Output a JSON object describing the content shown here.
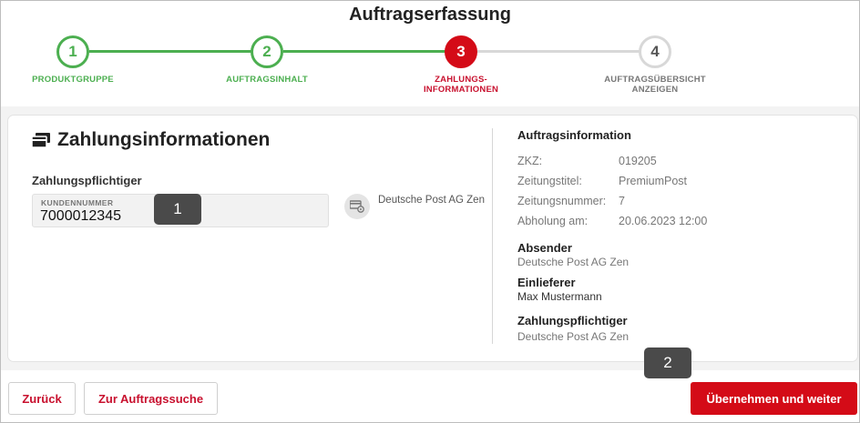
{
  "header": {
    "title": "Auftragserfassung"
  },
  "steps": [
    {
      "number": "1",
      "label": "PRODUKTGRUPPE",
      "state": "done"
    },
    {
      "number": "2",
      "label": "AUFTRAGSINHALT",
      "state": "done"
    },
    {
      "number": "3",
      "label": "ZAHLUNGS-\nINFORMATIONEN",
      "state": "active"
    },
    {
      "number": "4",
      "label": "AUFTRAGSÜBERSICHT\nANZEIGEN",
      "state": "todo"
    }
  ],
  "payment": {
    "section_title": "Zahlungsinformationen",
    "section_icon": "wallet-icon",
    "payer_label": "Zahlungspflichtiger",
    "customer_number_label": "KUNDENNUMMER",
    "customer_number_value": "7000012345",
    "card_button_icon": "credit-card-settings-icon",
    "card_holder": "Deutsche Post AG Zen"
  },
  "callouts": {
    "one": "1",
    "two": "2"
  },
  "order_info": {
    "title": "Auftragsinformation",
    "rows": [
      {
        "key": "ZKZ:",
        "value": "019205"
      },
      {
        "key": "Zeitungstitel:",
        "value": "PremiumPost"
      },
      {
        "key": "Zeitungsnummer:",
        "value": "7"
      },
      {
        "key": "Abholung am:",
        "value": "20.06.2023 12:00"
      }
    ],
    "sender_title": "Absender",
    "sender_value": "Deutsche Post AG Zen",
    "deliverer_title": "Einlieferer",
    "deliverer_value": "Max Mustermann",
    "payer_title": "Zahlungspflichtiger",
    "payer_value": "Deutsche Post AG Zen"
  },
  "footer": {
    "back_label": "Zurück",
    "search_label": "Zur Auftragssuche",
    "submit_label": "Übernehmen und weiter"
  },
  "colors": {
    "accent_red": "#d40b17",
    "done_green": "#4caf50",
    "todo_grey": "#d8d8d8"
  }
}
